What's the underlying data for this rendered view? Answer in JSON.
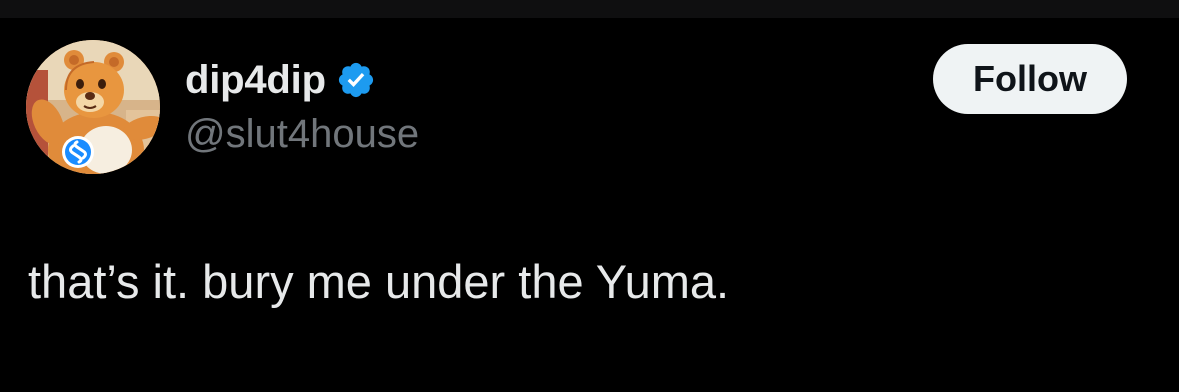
{
  "tweet": {
    "author": {
      "display_name": "dip4dip",
      "handle": "@slut4house",
      "verified": true,
      "avatar_icon": "bear-avatar-with-shazam-badge"
    },
    "follow_button_label": "Follow",
    "text": "that’s it. bury me under the Yuma."
  },
  "colors": {
    "background": "#000000",
    "primary_text": "#e7e9ea",
    "secondary_text": "#71767b",
    "verified_blue": "#1d9bf0",
    "follow_bg": "#eff3f4",
    "follow_text": "#0f1419"
  }
}
